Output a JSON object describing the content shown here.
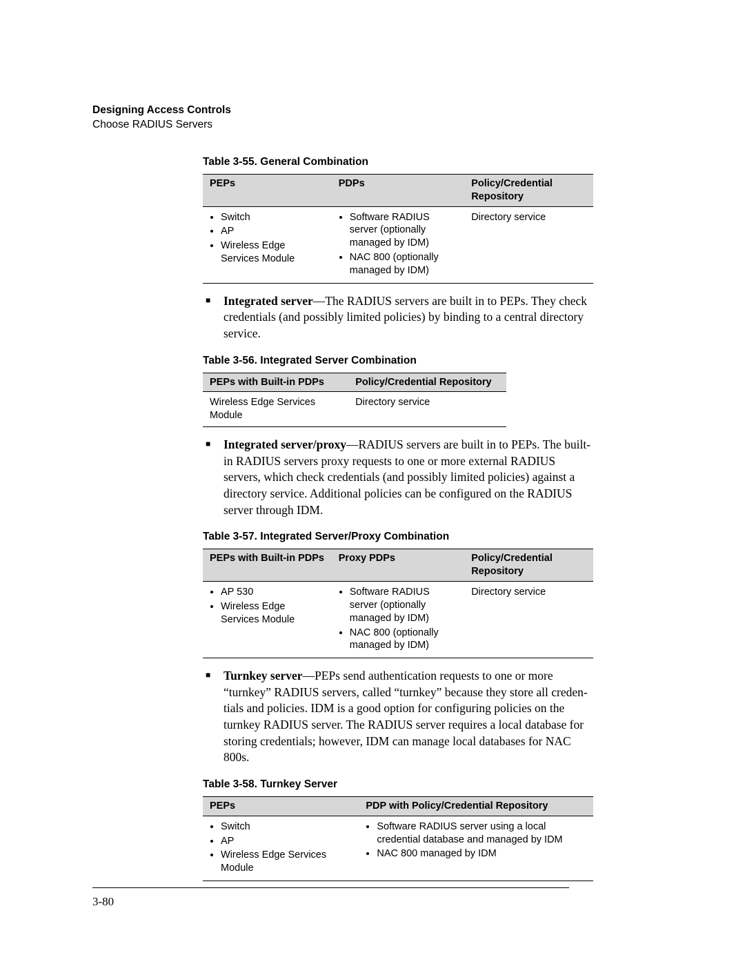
{
  "header": {
    "title": "Designing Access Controls",
    "subtitle": "Choose RADIUS Servers"
  },
  "table55": {
    "caption": "Table 3-55.   General Combination",
    "h1": "PEPs",
    "h2": "PDPs",
    "h3": "Policy/Credential Repository",
    "c1a": "Switch",
    "c1b": "AP",
    "c1c": "Wireless Edge Services Module",
    "c2a": "Software RADIUS server (optionally managed by IDM)",
    "c2b": "NAC 800 (optionally managed by IDM)",
    "c3": "Directory service"
  },
  "para1": {
    "lead": "Integrated server",
    "dash": "—",
    "text": "The RADIUS servers are built in to PEPs. They check credentials (and possibly limited policies) by binding to a central directory service."
  },
  "table56": {
    "caption": "Table 3-56.   Integrated Server Combination",
    "h1": "PEPs with Built-in PDPs",
    "h2": "Policy/Credential Repository",
    "c1": "Wireless Edge Services Module",
    "c2": "Directory service"
  },
  "para2": {
    "lead": "Integrated server/proxy",
    "dash": "—",
    "text": "RADIUS servers are built in to PEPs. The built-in RADIUS servers proxy requests to one or more external RADIUS servers, which check credentials (and possibly limited policies) against a directory service. Additional policies can be configured on the RADIUS server through IDM."
  },
  "table57": {
    "caption": "Table 3-57.   Integrated Server/Proxy Combination",
    "h1": "PEPs with Built-in PDPs",
    "h2": "Proxy PDPs",
    "h3": "Policy/Credential Repository",
    "c1a": "AP 530",
    "c1b": "Wireless Edge Services Module",
    "c2a": "Software RADIUS server (optionally managed by IDM)",
    "c2b": "NAC 800 (optionally managed by IDM)",
    "c3": "Directory service"
  },
  "para3": {
    "lead": "Turnkey server",
    "dash": "—",
    "text": "PEPs send authentication requests to one or more “turnkey” RADIUS servers, called “turnkey” because they store all creden­tials and policies. IDM is a good option for configuring policies on the turnkey RADIUS server. The RADIUS server requires a local database for storing credentials; however, IDM can manage local databases for NAC 800s."
  },
  "table58": {
    "caption": "Table 3-58.   Turnkey Server",
    "h1": "PEPs",
    "h2": "PDP with Policy/Credential Repository",
    "c1a": "Switch",
    "c1b": "AP",
    "c1c": "Wireless Edge Services Module",
    "c2a": "Software RADIUS server using a local credential database and managed by IDM",
    "c2b": "NAC 800 managed by IDM"
  },
  "pageNumber": "3-80"
}
